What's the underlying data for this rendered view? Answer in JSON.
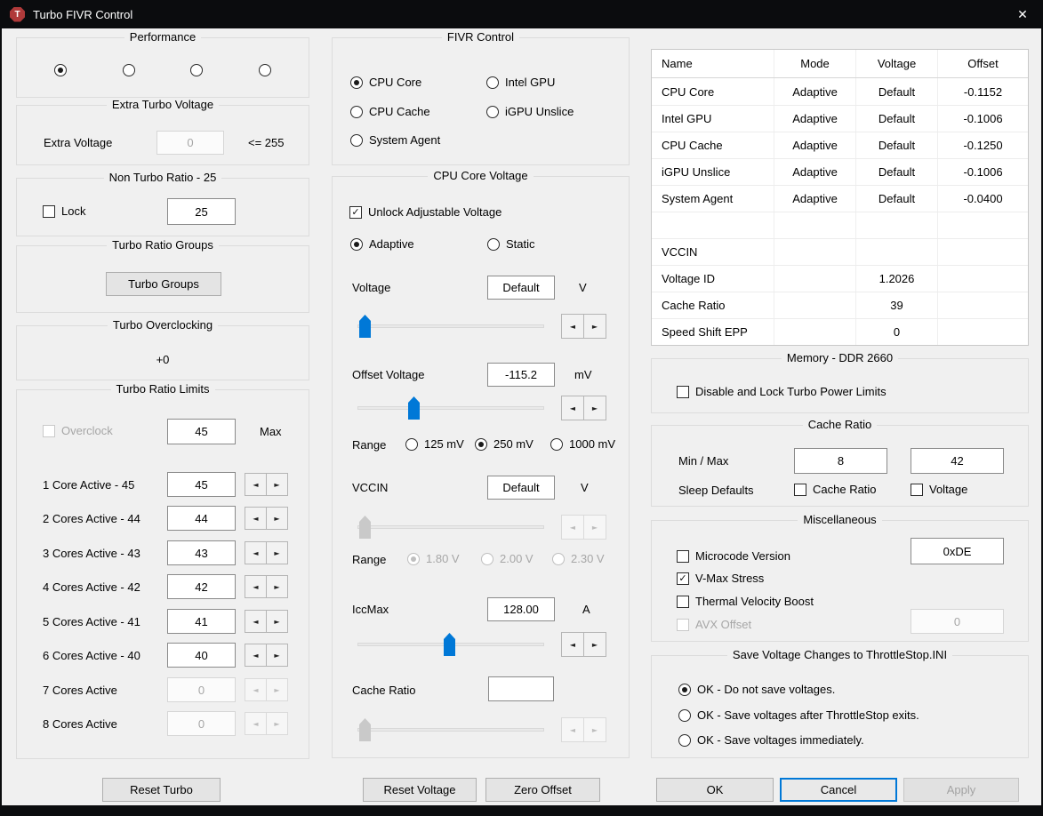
{
  "window": {
    "title": "Turbo FIVR Control"
  },
  "icons": {
    "app_initial": "T",
    "close": "✕",
    "check": "✓",
    "spin_left": "◄",
    "spin_right": "►"
  },
  "colors": {
    "accent": "#0078d7",
    "titlebar": "#0b0c0e",
    "body": "#f0f0f0",
    "slider_disabled": "#c9c9c9"
  },
  "performance": {
    "title": "Performance",
    "option_count": 4,
    "selected_index": 0
  },
  "extra_turbo": {
    "title": "Extra Turbo Voltage",
    "label": "Extra Voltage",
    "value": "0",
    "limit": "<= 255"
  },
  "non_turbo": {
    "title": "Non Turbo Ratio - 25",
    "lock_label": "Lock",
    "lock_checked": false,
    "value": "25"
  },
  "turbo_groups": {
    "title": "Turbo Ratio Groups",
    "button": "Turbo Groups"
  },
  "turbo_overclocking": {
    "title": "Turbo Overclocking",
    "value": "+0"
  },
  "turbo_limits": {
    "title": "Turbo Ratio Limits",
    "overclock_label": "Overclock",
    "overclock_enabled": false,
    "max_value": "45",
    "max_label": "Max",
    "rows": [
      {
        "label": "1 Core Active - 45",
        "value": "45",
        "enabled": true
      },
      {
        "label": "2 Cores Active - 44",
        "value": "44",
        "enabled": true
      },
      {
        "label": "3 Cores Active - 43",
        "value": "43",
        "enabled": true
      },
      {
        "label": "4 Cores Active - 42",
        "value": "42",
        "enabled": true
      },
      {
        "label": "5 Cores Active - 41",
        "value": "41",
        "enabled": true
      },
      {
        "label": "6 Cores Active - 40",
        "value": "40",
        "enabled": true
      },
      {
        "label": "7 Cores Active",
        "value": "0",
        "enabled": false
      },
      {
        "label": "8 Cores Active",
        "value": "0",
        "enabled": false
      }
    ]
  },
  "fivr": {
    "title": "FIVR Control",
    "options": [
      "CPU Core",
      "Intel GPU",
      "CPU Cache",
      "iGPU Unslice",
      "System Agent"
    ],
    "selected": "CPU Core"
  },
  "core_voltage": {
    "title": "CPU Core Voltage",
    "unlock_label": "Unlock Adjustable Voltage",
    "unlock_checked": true,
    "mode_options": [
      "Adaptive",
      "Static"
    ],
    "mode_selected": "Adaptive",
    "voltage": {
      "label": "Voltage",
      "value": "Default",
      "unit": "V",
      "slider_percent": 0
    },
    "offset": {
      "label": "Offset Voltage",
      "value": "-115.2",
      "unit": "mV",
      "slider_percent": 28
    },
    "offset_range": {
      "label": "Range",
      "options": [
        "125 mV",
        "250 mV",
        "1000 mV"
      ],
      "selected": "250 mV"
    },
    "vccin": {
      "label": "VCCIN",
      "value": "Default",
      "unit": "V",
      "slider_percent": 0,
      "disabled": true
    },
    "vccin_range": {
      "label": "Range",
      "options": [
        "1.80 V",
        "2.00 V",
        "2.30 V"
      ],
      "selected": "1.80 V",
      "disabled": true
    },
    "iccmax": {
      "label": "IccMax",
      "value": "128.00",
      "unit": "A",
      "slider_percent": 50
    },
    "cache_ratio": {
      "label": "Cache Ratio",
      "value": "",
      "slider_percent": 0,
      "disabled": true
    }
  },
  "voltage_table": {
    "headers": [
      "Name",
      "Mode",
      "Voltage",
      "Offset"
    ],
    "rows": [
      {
        "name": "CPU Core",
        "mode": "Adaptive",
        "voltage": "Default",
        "offset": "-0.1152"
      },
      {
        "name": "Intel GPU",
        "mode": "Adaptive",
        "voltage": "Default",
        "offset": "-0.1006"
      },
      {
        "name": "CPU Cache",
        "mode": "Adaptive",
        "voltage": "Default",
        "offset": "-0.1250"
      },
      {
        "name": "iGPU Unslice",
        "mode": "Adaptive",
        "voltage": "Default",
        "offset": "-0.1006"
      },
      {
        "name": "System Agent",
        "mode": "Adaptive",
        "voltage": "Default",
        "offset": "-0.0400"
      },
      {
        "name": "",
        "mode": "",
        "voltage": "",
        "offset": ""
      },
      {
        "name": "VCCIN",
        "mode": "",
        "voltage": "",
        "offset": ""
      },
      {
        "name": "Voltage ID",
        "mode": "",
        "voltage": "1.2026",
        "offset": ""
      },
      {
        "name": "Cache Ratio",
        "mode": "",
        "voltage": "39",
        "offset": ""
      },
      {
        "name": "Speed Shift EPP",
        "mode": "",
        "voltage": "0",
        "offset": ""
      }
    ]
  },
  "memory": {
    "title": "Memory - DDR 2660",
    "checkbox_label": "Disable and Lock Turbo Power Limits",
    "checked": false
  },
  "cache_ratio_box": {
    "title": "Cache Ratio",
    "minmax_label": "Min / Max",
    "min": "8",
    "max": "42",
    "sleep_label": "Sleep Defaults",
    "cb_cache": "Cache Ratio",
    "cb_voltage": "Voltage"
  },
  "misc": {
    "title": "Miscellaneous",
    "microcode_label": "Microcode Version",
    "microcode_checked": false,
    "microcode_value": "0xDE",
    "vmax_label": "V-Max Stress",
    "vmax_checked": true,
    "tvb_label": "Thermal Velocity Boost",
    "tvb_checked": false,
    "avx_label": "AVX Offset",
    "avx_enabled": false,
    "avx_value": "0"
  },
  "save": {
    "title": "Save Voltage Changes to ThrottleStop.INI",
    "options": [
      "OK - Do not save voltages.",
      "OK - Save voltages after ThrottleStop exits.",
      "OK - Save voltages immediately."
    ],
    "selected": "OK - Do not save voltages."
  },
  "buttons": {
    "reset_turbo": "Reset Turbo",
    "reset_voltage": "Reset Voltage",
    "zero_offset": "Zero Offset",
    "ok": "OK",
    "cancel": "Cancel",
    "apply": "Apply"
  }
}
